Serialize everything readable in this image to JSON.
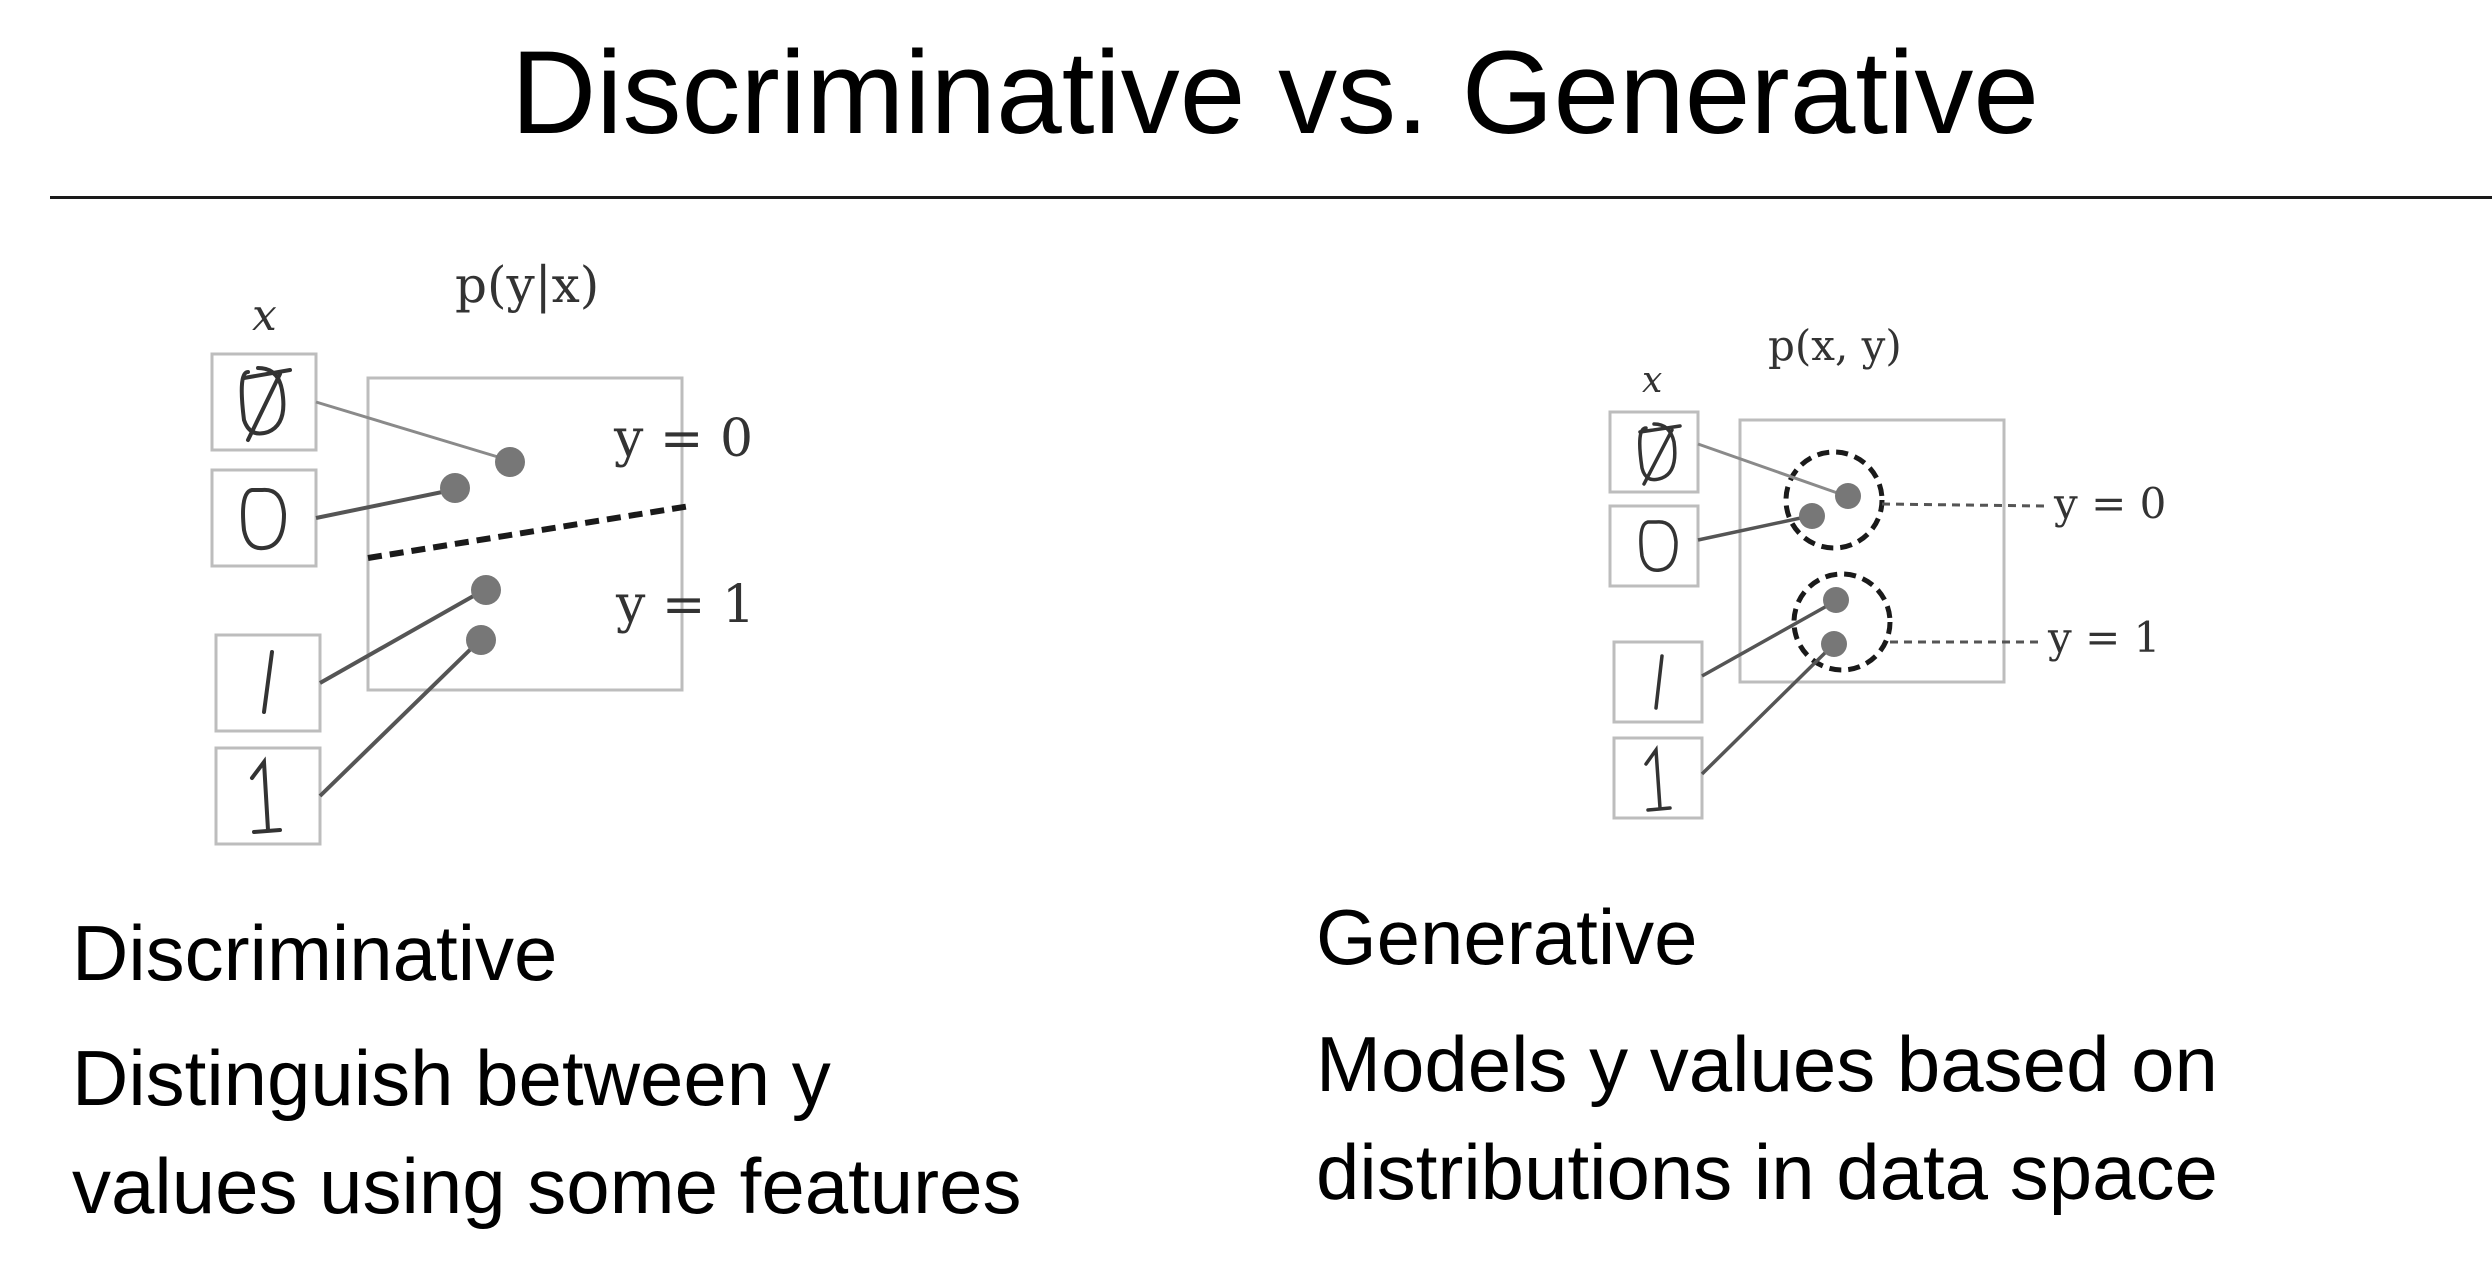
{
  "slide": {
    "title": "Discriminative vs. Generative"
  },
  "discriminative": {
    "input_label": "x",
    "distribution_label": "p(y|x)",
    "class0_label": "y = 0",
    "class1_label": "y = 1",
    "heading": "Discriminative",
    "description_line1": "Distinguish between y",
    "description_line2": "values using some features"
  },
  "generative": {
    "input_label": "x",
    "distribution_label": "p(x, y)",
    "class0_label": "y = 0",
    "class1_label": "y = 1",
    "heading": "Generative",
    "description_line1": "Models y values based on",
    "description_line2": "distributions in data space"
  },
  "colors": {
    "box_stroke": "#bdbdbd",
    "point_fill": "#777777",
    "connector": "#8a8a8a",
    "boundary": "#1a1a1a",
    "digit_ink": "#333333"
  }
}
